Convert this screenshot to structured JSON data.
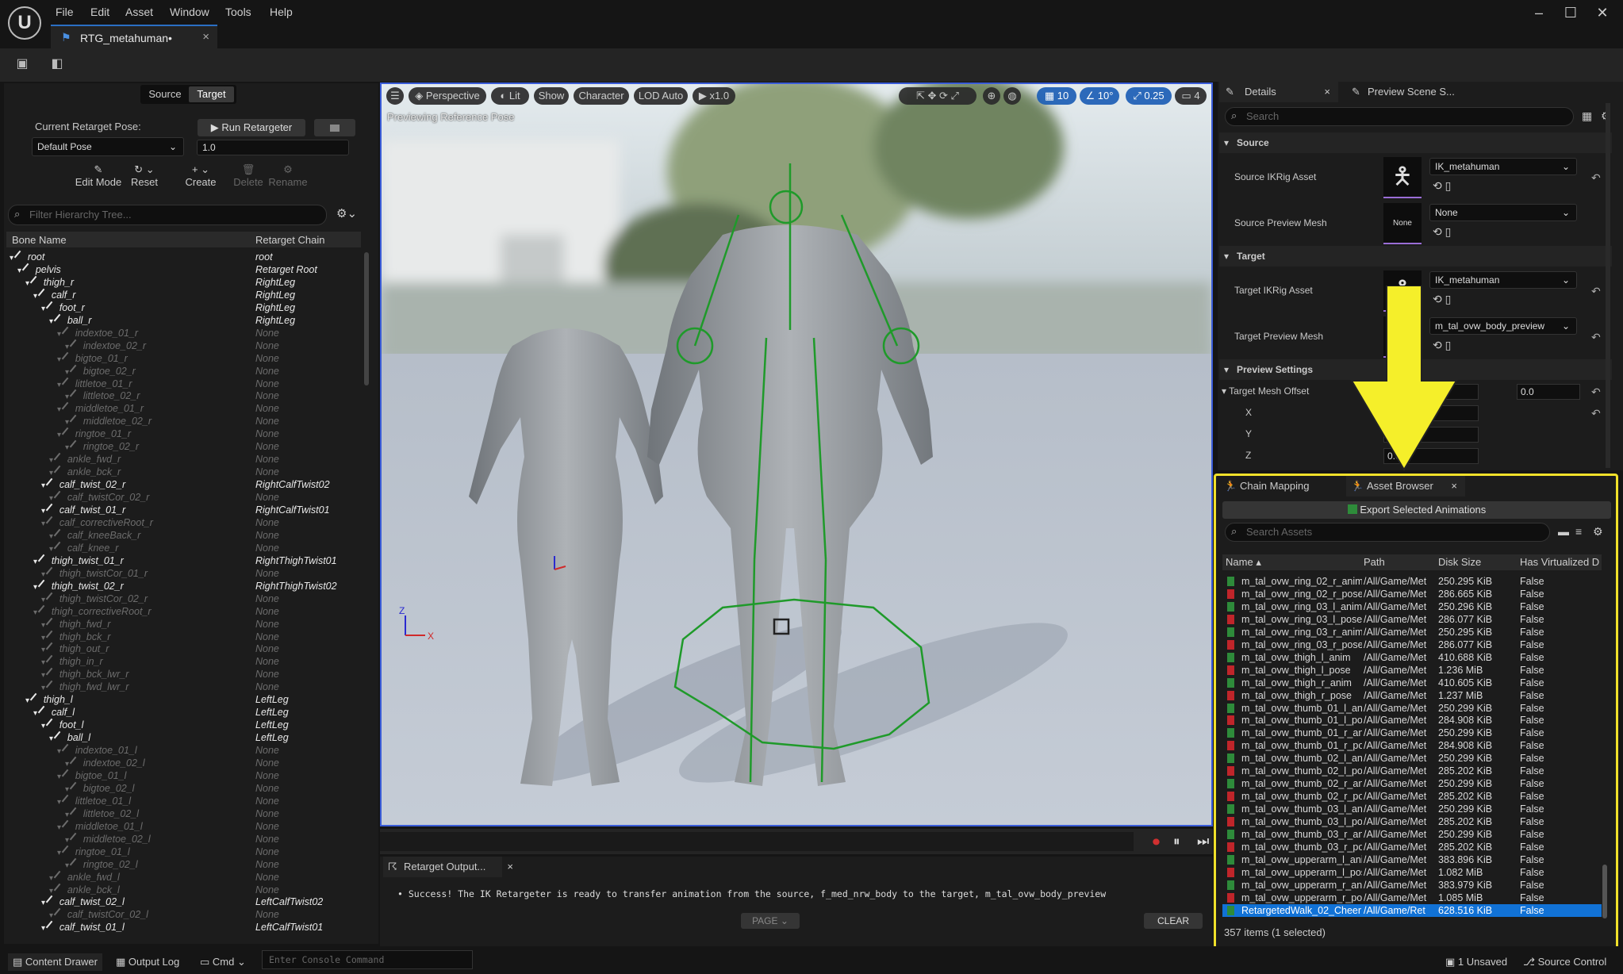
{
  "menu": [
    "File",
    "Edit",
    "Asset",
    "Window",
    "Tools",
    "Help"
  ],
  "doc_tab": "RTG_metahuman•",
  "source_target": {
    "source": "Source",
    "target": "Target"
  },
  "retarget_pose": {
    "label": "Current Retarget Pose:",
    "value": "Default Pose",
    "run_label": "Run Retargeter",
    "blend": "1.0"
  },
  "tools": {
    "edit_mode": "Edit Mode",
    "reset": "Reset",
    "create": "Create",
    "delete": "Delete",
    "rename": "Rename"
  },
  "hierarchy": {
    "placeholder": "Filter Hierarchy Tree...",
    "col_bone": "Bone Name",
    "col_chain": "Retarget Chain",
    "rows": [
      {
        "name": "root",
        "chain": "root",
        "depth": 0,
        "on": true
      },
      {
        "name": "pelvis",
        "chain": "Retarget Root",
        "depth": 1,
        "on": true
      },
      {
        "name": "thigh_r",
        "chain": "RightLeg",
        "depth": 2,
        "on": true
      },
      {
        "name": "calf_r",
        "chain": "RightLeg",
        "depth": 3,
        "on": true
      },
      {
        "name": "foot_r",
        "chain": "RightLeg",
        "depth": 4,
        "on": true
      },
      {
        "name": "ball_r",
        "chain": "RightLeg",
        "depth": 5,
        "on": true
      },
      {
        "name": "indextoe_01_r",
        "chain": "None",
        "depth": 6,
        "on": false
      },
      {
        "name": "indextoe_02_r",
        "chain": "None",
        "depth": 7,
        "on": false
      },
      {
        "name": "bigtoe_01_r",
        "chain": "None",
        "depth": 6,
        "on": false
      },
      {
        "name": "bigtoe_02_r",
        "chain": "None",
        "depth": 7,
        "on": false
      },
      {
        "name": "littletoe_01_r",
        "chain": "None",
        "depth": 6,
        "on": false
      },
      {
        "name": "littletoe_02_r",
        "chain": "None",
        "depth": 7,
        "on": false
      },
      {
        "name": "middletoe_01_r",
        "chain": "None",
        "depth": 6,
        "on": false
      },
      {
        "name": "middletoe_02_r",
        "chain": "None",
        "depth": 7,
        "on": false
      },
      {
        "name": "ringtoe_01_r",
        "chain": "None",
        "depth": 6,
        "on": false
      },
      {
        "name": "ringtoe_02_r",
        "chain": "None",
        "depth": 7,
        "on": false
      },
      {
        "name": "ankle_fwd_r",
        "chain": "None",
        "depth": 5,
        "on": false
      },
      {
        "name": "ankle_bck_r",
        "chain": "None",
        "depth": 5,
        "on": false
      },
      {
        "name": "calf_twist_02_r",
        "chain": "RightCalfTwist02",
        "depth": 4,
        "on": true
      },
      {
        "name": "calf_twistCor_02_r",
        "chain": "None",
        "depth": 5,
        "on": false
      },
      {
        "name": "calf_twist_01_r",
        "chain": "RightCalfTwist01",
        "depth": 4,
        "on": true
      },
      {
        "name": "calf_correctiveRoot_r",
        "chain": "None",
        "depth": 4,
        "on": false
      },
      {
        "name": "calf_kneeBack_r",
        "chain": "None",
        "depth": 5,
        "on": false
      },
      {
        "name": "calf_knee_r",
        "chain": "None",
        "depth": 5,
        "on": false
      },
      {
        "name": "thigh_twist_01_r",
        "chain": "RightThighTwist01",
        "depth": 3,
        "on": true
      },
      {
        "name": "thigh_twistCor_01_r",
        "chain": "None",
        "depth": 4,
        "on": false
      },
      {
        "name": "thigh_twist_02_r",
        "chain": "RightThighTwist02",
        "depth": 3,
        "on": true
      },
      {
        "name": "thigh_twistCor_02_r",
        "chain": "None",
        "depth": 4,
        "on": false
      },
      {
        "name": "thigh_correctiveRoot_r",
        "chain": "None",
        "depth": 3,
        "on": false
      },
      {
        "name": "thigh_fwd_r",
        "chain": "None",
        "depth": 4,
        "on": false
      },
      {
        "name": "thigh_bck_r",
        "chain": "None",
        "depth": 4,
        "on": false
      },
      {
        "name": "thigh_out_r",
        "chain": "None",
        "depth": 4,
        "on": false
      },
      {
        "name": "thigh_in_r",
        "chain": "None",
        "depth": 4,
        "on": false
      },
      {
        "name": "thigh_bck_lwr_r",
        "chain": "None",
        "depth": 4,
        "on": false
      },
      {
        "name": "thigh_fwd_lwr_r",
        "chain": "None",
        "depth": 4,
        "on": false
      },
      {
        "name": "thigh_l",
        "chain": "LeftLeg",
        "depth": 2,
        "on": true
      },
      {
        "name": "calf_l",
        "chain": "LeftLeg",
        "depth": 3,
        "on": true
      },
      {
        "name": "foot_l",
        "chain": "LeftLeg",
        "depth": 4,
        "on": true
      },
      {
        "name": "ball_l",
        "chain": "LeftLeg",
        "depth": 5,
        "on": true
      },
      {
        "name": "indextoe_01_l",
        "chain": "None",
        "depth": 6,
        "on": false
      },
      {
        "name": "indextoe_02_l",
        "chain": "None",
        "depth": 7,
        "on": false
      },
      {
        "name": "bigtoe_01_l",
        "chain": "None",
        "depth": 6,
        "on": false
      },
      {
        "name": "bigtoe_02_l",
        "chain": "None",
        "depth": 7,
        "on": false
      },
      {
        "name": "littletoe_01_l",
        "chain": "None",
        "depth": 6,
        "on": false
      },
      {
        "name": "littletoe_02_l",
        "chain": "None",
        "depth": 7,
        "on": false
      },
      {
        "name": "middletoe_01_l",
        "chain": "None",
        "depth": 6,
        "on": false
      },
      {
        "name": "middletoe_02_l",
        "chain": "None",
        "depth": 7,
        "on": false
      },
      {
        "name": "ringtoe_01_l",
        "chain": "None",
        "depth": 6,
        "on": false
      },
      {
        "name": "ringtoe_02_l",
        "chain": "None",
        "depth": 7,
        "on": false
      },
      {
        "name": "ankle_fwd_l",
        "chain": "None",
        "depth": 5,
        "on": false
      },
      {
        "name": "ankle_bck_l",
        "chain": "None",
        "depth": 5,
        "on": false
      },
      {
        "name": "calf_twist_02_l",
        "chain": "LeftCalfTwist02",
        "depth": 4,
        "on": true
      },
      {
        "name": "calf_twistCor_02_l",
        "chain": "None",
        "depth": 5,
        "on": false
      },
      {
        "name": "calf_twist_01_l",
        "chain": "LeftCalfTwist01",
        "depth": 4,
        "on": true
      }
    ]
  },
  "viewport": {
    "perspective": "Perspective",
    "lit": "Lit",
    "show": "Show",
    "character": "Character",
    "lod": "LOD Auto",
    "speed": "x1.0",
    "grid": "10",
    "angle": "10°",
    "scale": "0.25",
    "cam": "4",
    "label": "Previewing Reference Pose"
  },
  "output": {
    "tab": "Retarget Output...",
    "message": "Success! The IK Retargeter is ready to transfer animation from the source, f_med_nrw_body to the target, m_tal_ovw_body_preview",
    "page": "PAGE",
    "clear": "CLEAR"
  },
  "details": {
    "tab": "Details",
    "tab2": "Preview Scene S...",
    "search": "Search",
    "source_section": "Source",
    "source_ikrig_label": "Source IKRig Asset",
    "source_ikrig": "IK_metahuman",
    "source_mesh_label": "Source Preview Mesh",
    "source_mesh": "None",
    "none_thumb": "None",
    "target_section": "Target",
    "target_ikrig_label": "Target IKRig Asset",
    "target_ikrig": "IK_metahuman",
    "target_mesh_label": "Target Preview Mesh",
    "target_mesh": "m_tal_ovw_body_preview",
    "preview_section": "Preview Settings",
    "offset_label": "Target Mesh Offset",
    "offset_a": "0.0",
    "offset_b": "0.0",
    "x": "X",
    "y": "Y",
    "z": "Z",
    "z_val": "0.0"
  },
  "asset_browser": {
    "tab_chain": "Chain Mapping",
    "tab_assets": "Asset Browser",
    "export": "Export Selected Animations",
    "search": "Search Assets",
    "columns": [
      "Name",
      "Path",
      "Disk Size",
      "Has Virtualized D"
    ],
    "rows": [
      {
        "name": "m_tal_ovw_ring_02_r_anim",
        "path": "/All/Game/Met",
        "size": "250.295 KiB",
        "virt": "False",
        "color": "#2e8b3a"
      },
      {
        "name": "m_tal_ovw_ring_02_r_pose",
        "path": "/All/Game/Met",
        "size": "286.665 KiB",
        "virt": "False",
        "color": "#c0252a"
      },
      {
        "name": "m_tal_ovw_ring_03_l_anim",
        "path": "/All/Game/Met",
        "size": "250.296 KiB",
        "virt": "False",
        "color": "#2e8b3a"
      },
      {
        "name": "m_tal_ovw_ring_03_l_pose",
        "path": "/All/Game/Met",
        "size": "286.077 KiB",
        "virt": "False",
        "color": "#c0252a"
      },
      {
        "name": "m_tal_ovw_ring_03_r_anim",
        "path": "/All/Game/Met",
        "size": "250.295 KiB",
        "virt": "False",
        "color": "#2e8b3a"
      },
      {
        "name": "m_tal_ovw_ring_03_r_pose",
        "path": "/All/Game/Met",
        "size": "286.077 KiB",
        "virt": "False",
        "color": "#c0252a"
      },
      {
        "name": "m_tal_ovw_thigh_l_anim",
        "path": "/All/Game/Met",
        "size": "410.688 KiB",
        "virt": "False",
        "color": "#2e8b3a"
      },
      {
        "name": "m_tal_ovw_thigh_l_pose",
        "path": "/All/Game/Met",
        "size": "1.236 MiB",
        "virt": "False",
        "color": "#c0252a"
      },
      {
        "name": "m_tal_ovw_thigh_r_anim",
        "path": "/All/Game/Met",
        "size": "410.605 KiB",
        "virt": "False",
        "color": "#2e8b3a"
      },
      {
        "name": "m_tal_ovw_thigh_r_pose",
        "path": "/All/Game/Met",
        "size": "1.237 MiB",
        "virt": "False",
        "color": "#c0252a"
      },
      {
        "name": "m_tal_ovw_thumb_01_l_anim",
        "path": "/All/Game/Met",
        "size": "250.299 KiB",
        "virt": "False",
        "color": "#2e8b3a"
      },
      {
        "name": "m_tal_ovw_thumb_01_l_pose",
        "path": "/All/Game/Met",
        "size": "284.908 KiB",
        "virt": "False",
        "color": "#c0252a"
      },
      {
        "name": "m_tal_ovw_thumb_01_r_anim",
        "path": "/All/Game/Met",
        "size": "250.299 KiB",
        "virt": "False",
        "color": "#2e8b3a"
      },
      {
        "name": "m_tal_ovw_thumb_01_r_pose",
        "path": "/All/Game/Met",
        "size": "284.908 KiB",
        "virt": "False",
        "color": "#c0252a"
      },
      {
        "name": "m_tal_ovw_thumb_02_l_anim",
        "path": "/All/Game/Met",
        "size": "250.299 KiB",
        "virt": "False",
        "color": "#2e8b3a"
      },
      {
        "name": "m_tal_ovw_thumb_02_l_pose",
        "path": "/All/Game/Met",
        "size": "285.202 KiB",
        "virt": "False",
        "color": "#c0252a"
      },
      {
        "name": "m_tal_ovw_thumb_02_r_anim",
        "path": "/All/Game/Met",
        "size": "250.299 KiB",
        "virt": "False",
        "color": "#2e8b3a"
      },
      {
        "name": "m_tal_ovw_thumb_02_r_pose",
        "path": "/All/Game/Met",
        "size": "285.202 KiB",
        "virt": "False",
        "color": "#c0252a"
      },
      {
        "name": "m_tal_ovw_thumb_03_l_anim",
        "path": "/All/Game/Met",
        "size": "250.299 KiB",
        "virt": "False",
        "color": "#2e8b3a"
      },
      {
        "name": "m_tal_ovw_thumb_03_l_pose",
        "path": "/All/Game/Met",
        "size": "285.202 KiB",
        "virt": "False",
        "color": "#c0252a"
      },
      {
        "name": "m_tal_ovw_thumb_03_r_anim",
        "path": "/All/Game/Met",
        "size": "250.299 KiB",
        "virt": "False",
        "color": "#2e8b3a"
      },
      {
        "name": "m_tal_ovw_thumb_03_r_pose",
        "path": "/All/Game/Met",
        "size": "285.202 KiB",
        "virt": "False",
        "color": "#c0252a"
      },
      {
        "name": "m_tal_ovw_upperarm_l_anim",
        "path": "/All/Game/Met",
        "size": "383.896 KiB",
        "virt": "False",
        "color": "#2e8b3a"
      },
      {
        "name": "m_tal_ovw_upperarm_l_pose",
        "path": "/All/Game/Met",
        "size": "1.082 MiB",
        "virt": "False",
        "color": "#c0252a"
      },
      {
        "name": "m_tal_ovw_upperarm_r_anim",
        "path": "/All/Game/Met",
        "size": "383.979 KiB",
        "virt": "False",
        "color": "#2e8b3a"
      },
      {
        "name": "m_tal_ovw_upperarm_r_pose",
        "path": "/All/Game/Met",
        "size": "1.085 MiB",
        "virt": "False",
        "color": "#c0252a"
      },
      {
        "name": "RetargetedWalk_02_Cheer",
        "path": "/All/Game/Ret",
        "size": "628.516 KiB",
        "virt": "False",
        "color": "#2e8b3a",
        "selected": true
      }
    ],
    "count": "357 items (1 selected)"
  },
  "statusbar": {
    "content_drawer": "Content Drawer",
    "output_log": "Output Log",
    "cmd": "Cmd",
    "console_placeholder": "Enter Console Command",
    "unsaved": "1 Unsaved",
    "source_control": "Source Control"
  },
  "colors": {
    "accent": "#3a5cd8",
    "highlight": "#f0e02a",
    "selection": "#1172d6",
    "arrow": "#f5ef2a",
    "skeleton": "#1f9a2a"
  }
}
